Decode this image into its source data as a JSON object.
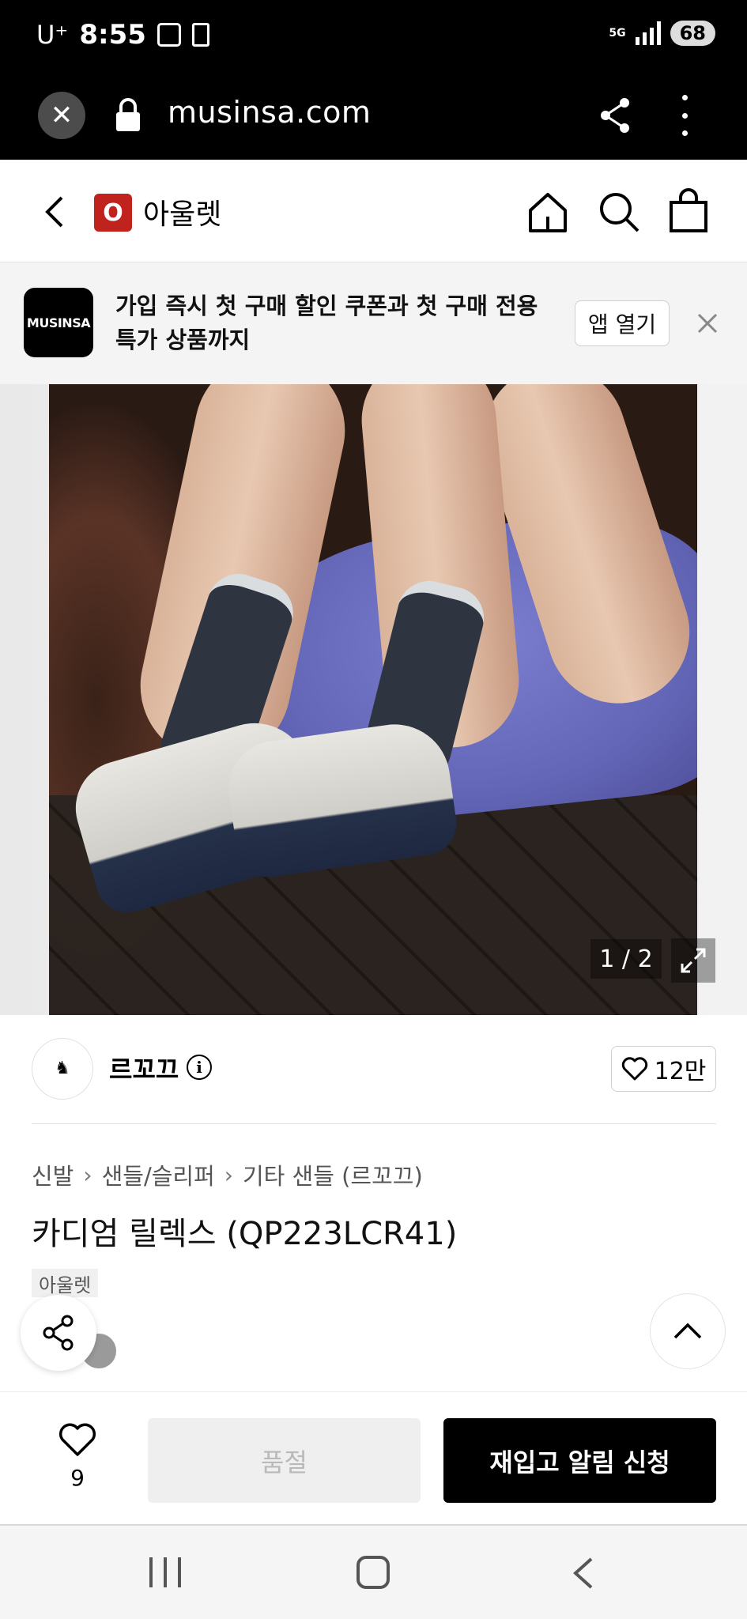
{
  "status_bar": {
    "carrier": "U⁺",
    "time": "8:55",
    "network": "5G",
    "battery": "68"
  },
  "browser": {
    "url": "musinsa.com",
    "icons": [
      "close-icon",
      "lock-icon",
      "share-icon",
      "more-icon"
    ]
  },
  "app_header": {
    "logo_letter": "O",
    "title": "아울렛",
    "icons": [
      "back-icon",
      "home-icon",
      "search-icon",
      "bag-icon"
    ]
  },
  "banner": {
    "logo_text": "MUSINSA",
    "message": "가입 즉시 첫 구매 할인 쿠폰과 첫 구매 전용 특가 상품까지",
    "open_app_label": "앱 열기"
  },
  "gallery": {
    "counter": "1 / 2"
  },
  "brand": {
    "name": "르꼬끄",
    "likes": "12만"
  },
  "product": {
    "breadcrumb": [
      "신발",
      "샌들/슬리퍼",
      "기타 샌들 (르꼬끄)"
    ],
    "title": "카디엄 릴렉스 (QP223LCR41)",
    "tag": "아울렛"
  },
  "purchase_bar": {
    "wishlist_count": "9",
    "soldout_label": "품절",
    "restock_label": "재입고 알림 신청"
  },
  "colors": {
    "accent_red": "#c0221d",
    "primary_black": "#000000",
    "disabled_bg": "#efefef"
  }
}
